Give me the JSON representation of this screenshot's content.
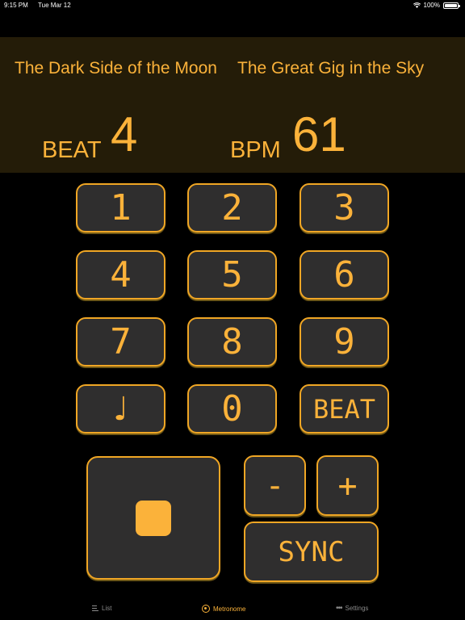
{
  "status_bar": {
    "time": "9:15 PM",
    "date": "Tue Mar 12",
    "battery": "100%",
    "battery_level": 1.0
  },
  "now_playing": {
    "album": "The Dark Side of the Moon",
    "track": "The Great Gig in the Sky"
  },
  "readout": {
    "beat_label": "BEAT",
    "beat_value": "4",
    "bpm_label": "BPM",
    "bpm_value": "61"
  },
  "keypad": {
    "k1": "1",
    "k2": "2",
    "k3": "3",
    "k4": "4",
    "k5": "5",
    "k6": "6",
    "k7": "7",
    "k8": "8",
    "k9": "9",
    "note": "♩",
    "k0": "0",
    "beat": "BEAT"
  },
  "controls": {
    "minus": "-",
    "plus": "+",
    "sync": "SYNC",
    "stop_icon": "stop-icon"
  },
  "tabs": [
    {
      "label": "List",
      "icon": "list-icon"
    },
    {
      "label": "Metronome",
      "icon": "metronome-icon",
      "active": true
    },
    {
      "label": "Settings",
      "icon": "more-icon"
    }
  ],
  "colors": {
    "accent": "#fbb23a",
    "key_bg": "#2f2e2e",
    "key_border": "#f0a624",
    "panel_bg": "#241c08",
    "background": "#000000"
  }
}
